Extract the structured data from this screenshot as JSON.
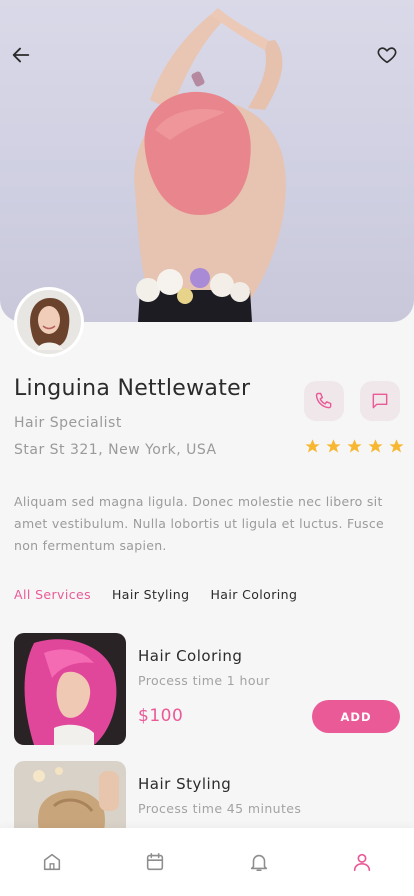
{
  "colors": {
    "accent": "#ea5a96",
    "star": "#f7b731",
    "action_bg": "#efe7ea",
    "text": "#2b2b2b",
    "muted": "#9a9a9a"
  },
  "header": {
    "back_icon": "arrow-left-icon",
    "favorite_icon": "heart-icon"
  },
  "profile": {
    "name": "Linguina Nettlewater",
    "role": "Hair Specialist",
    "address": "Star St 321, New York, USA",
    "rating": 5,
    "rating_max": 5,
    "call_icon": "phone-icon",
    "message_icon": "message-icon"
  },
  "description": "Aliquam sed magna ligula. Donec molestie nec libero sit amet vestibulum. Nulla lobortis ut ligula et luctus. Fusce non fermentum sapien.",
  "tabs": [
    {
      "label": "All Services",
      "active": true
    },
    {
      "label": "Hair Styling",
      "active": false
    },
    {
      "label": "Hair Coloring",
      "active": false
    }
  ],
  "services": [
    {
      "title": "Hair Coloring",
      "time": "Process time 1 hour",
      "price": "$100",
      "add_label": "ADD"
    },
    {
      "title": "Hair Styling",
      "time": "Process time 45 minutes"
    }
  ],
  "bottom_nav": [
    {
      "icon": "home-icon",
      "active": false
    },
    {
      "icon": "calendar-icon",
      "active": false
    },
    {
      "icon": "bell-icon",
      "active": false
    },
    {
      "icon": "user-icon",
      "active": true
    }
  ]
}
